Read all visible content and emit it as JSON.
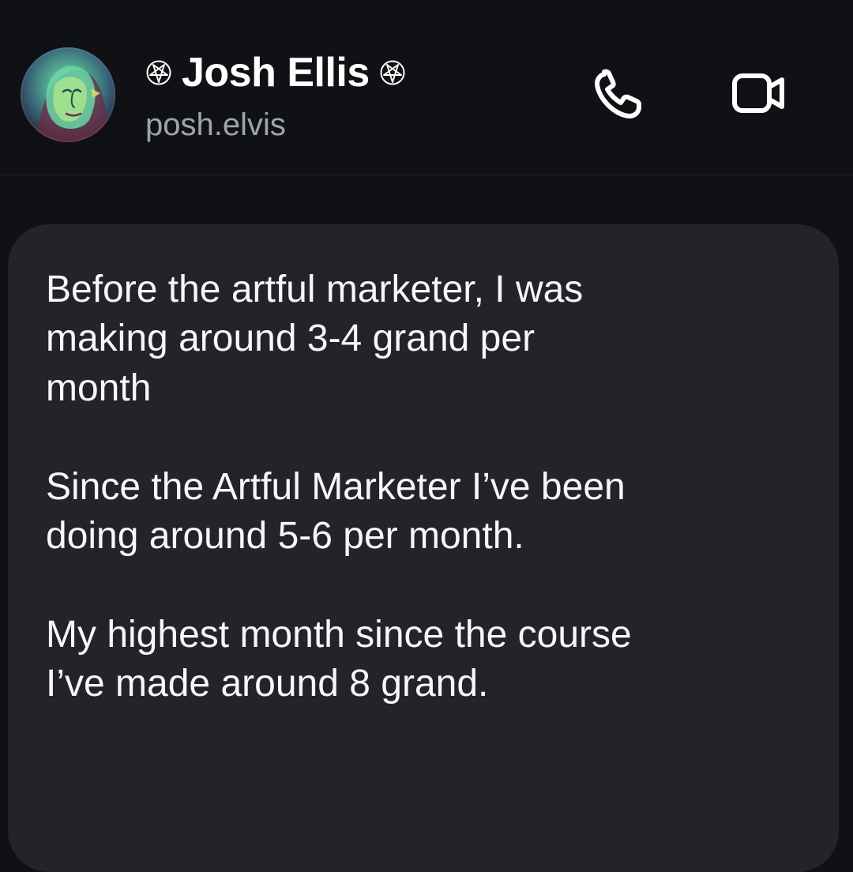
{
  "header": {
    "name": "Josh Ellis",
    "username": "posh.elvis",
    "icons": {
      "left_star": "pentagram-icon",
      "right_star": "pentagram-icon",
      "phone": "phone-icon",
      "video": "video-camera-icon"
    }
  },
  "message": {
    "text": "Before the artful marketer, I was\nmaking around 3-4 grand per\nmonth\n\nSince the Artful Marketer I’ve been\ndoing around 5-6 per month.\n\nMy highest month since the course\nI’ve made around 8 grand."
  },
  "colors": {
    "background": "#0f1115",
    "bubble": "#222429",
    "text_primary": "#ffffff",
    "text_secondary": "#a0a4ab"
  }
}
